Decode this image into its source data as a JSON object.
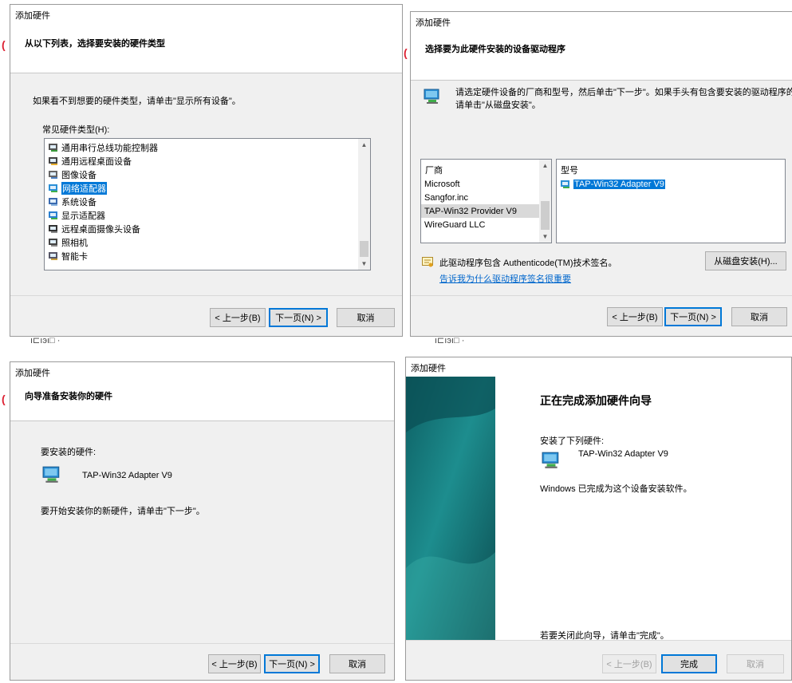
{
  "panel1": {
    "window_title": "添加硬件",
    "header_title": "从以下列表，选择要安装的硬件类型",
    "instruction": "如果看不到想要的硬件类型，请单击\"显示所有设备\"。",
    "list_label": "常见硬件类型(H):",
    "items": [
      {
        "label": "通用串行总线功能控制器",
        "icon": "usb-controller-icon"
      },
      {
        "label": "通用远程桌面设备",
        "icon": "remote-desktop-device-icon"
      },
      {
        "label": "图像设备",
        "icon": "imaging-device-icon"
      },
      {
        "label": "网络适配器",
        "icon": "network-adapter-icon",
        "selected": true
      },
      {
        "label": "系统设备",
        "icon": "system-device-icon"
      },
      {
        "label": "显示适配器",
        "icon": "display-adapter-icon"
      },
      {
        "label": "远程桌面摄像头设备",
        "icon": "remote-camera-icon"
      },
      {
        "label": "照相机",
        "icon": "camera-icon"
      },
      {
        "label": "智能卡",
        "icon": "smart-card-icon"
      }
    ],
    "back_label": "< 上一步(B)",
    "next_label": "下一页(N) >",
    "cancel_label": "取消"
  },
  "panel2": {
    "window_title": "添加硬件",
    "header_title": "选择要为此硬件安装的设备驱动程序",
    "instruction_line1": "请选定硬件设备的厂商和型号，然后单击\"下一步\"。如果手头有包含要安装的驱动程序的磁盘，",
    "instruction_line2": "请单击\"从磁盘安装\"。",
    "manufacturer_header": "厂商",
    "manufacturers": [
      {
        "label": "Microsoft"
      },
      {
        "label": "Sangfor.inc"
      },
      {
        "label": "TAP-Win32 Provider V9",
        "selected": true
      },
      {
        "label": "WireGuard LLC"
      }
    ],
    "model_header": "型号",
    "models": [
      {
        "label": "TAP-Win32 Adapter V9",
        "selected": true
      }
    ],
    "signed_text": "此驱动程序包含 Authenticode(TM)技术签名。",
    "signing_link": "告诉我为什么驱动程序签名很重要",
    "have_disk_label": "从磁盘安装(H)...",
    "back_label": "< 上一步(B)",
    "next_label": "下一页(N) >",
    "cancel_label": "取消"
  },
  "panel3": {
    "window_title": "添加硬件",
    "header_title": "向导准备安装你的硬件",
    "to_install_label": "要安装的硬件:",
    "device_name": "TAP-Win32 Adapter V9",
    "start_text": "要开始安装你的新硬件，请单击\"下一步\"。",
    "back_label": "< 上一步(B)",
    "next_label": "下一页(N) >",
    "cancel_label": "取消"
  },
  "panel4": {
    "window_title": "添加硬件",
    "heading": "正在完成添加硬件向导",
    "installed_label": "安装了下列硬件:",
    "device_name": "TAP-Win32 Adapter V9",
    "done_text": "Windows 已完成为这个设备安装软件。",
    "close_text": "若要关闭此向导，请单击\"完成\"。",
    "back_label": "< 上一步(B)",
    "finish_label": "完成",
    "cancel_label": "取消"
  },
  "colors": {
    "accent": "#0078d7",
    "dialog_bg": "#f0f0f0",
    "link": "#0066cc",
    "banner_teal": "#1d8d8e"
  }
}
